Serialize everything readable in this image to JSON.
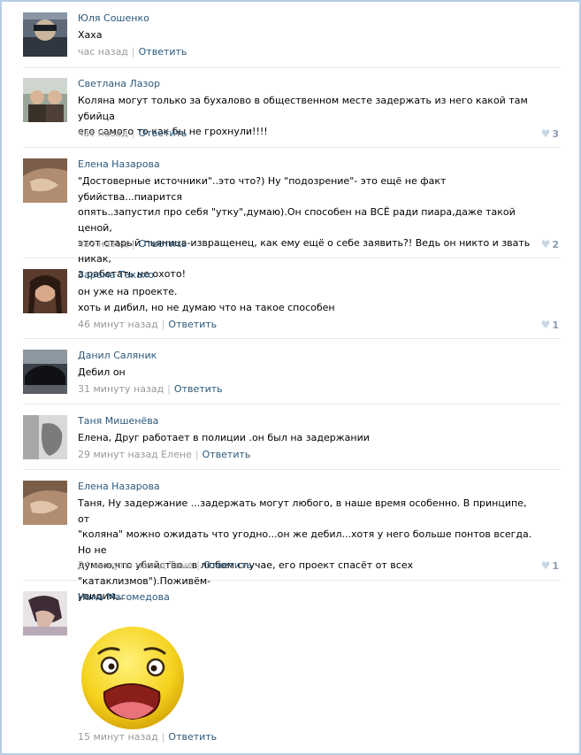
{
  "comments": [
    {
      "author": "Юля Сошенко",
      "lines": [
        "Хаха"
      ],
      "time": "час назад",
      "reply": "Ответить",
      "likes": ""
    },
    {
      "author": "Светлана Лазор",
      "lines": [
        "Коляна могут только за бухалово в общественном месте задержать из него какой там убийца",
        "его самого то как бы не грохнули!!!!"
      ],
      "time": "час назад",
      "reply": "Ответить",
      "likes": "3"
    },
    {
      "author": "Елена Назарова",
      "lines": [
        "\"Достоверные источники\"..это что?) Ну \"подозрение\"- это ещё не факт убийства...пиарится",
        "опять..запустил про себя \"утку\",думаю).Он способен на ВСЁ ради пиара,даже такой ценой,",
        "этот старый пьяница-извращенец, как ему ещё о себе заявить?! Ведь он никто и звать никак,",
        "а работать не охото!"
      ],
      "time": "час назад",
      "reply": "Ответить",
      "likes": "2"
    },
    {
      "author": "Зарема Такахо",
      "lines": [
        "он уже на проекте.",
        "хоть и дибил, но не думаю что на такое способен"
      ],
      "time": "46 минут назад",
      "reply": "Ответить",
      "likes": "1"
    },
    {
      "author": "Данил Саляник",
      "lines": [
        "Дебил он"
      ],
      "time": "31 минуту назад",
      "reply": "Ответить",
      "likes": ""
    },
    {
      "author": "Таня Мишенёва",
      "lines": [
        "Елена, Друг работает в полиции .он был на задержании"
      ],
      "time": "29 минут назад Елене",
      "reply": "Ответить",
      "likes": ""
    },
    {
      "author": "Елена Назарова",
      "lines": [
        "Таня, Ну задержание ...задержать могут любого, в наше время особенно. В принципе, от",
        "\"коляна\" можно ожидать что угодно...он же дебил...хотя у него больше понтов всегда. Но не",
        "думаю,что убийство...в любом случае, его проект спасёт от всех \"катаклизмов\").Поживём-",
        "увидим..."
      ],
      "time": "24 минуты назад Тане",
      "reply": "Ответить",
      "likes": "1"
    },
    {
      "author": "Нана Магомедова",
      "lines": [],
      "time": "15 минут назад",
      "reply": "Ответить",
      "likes": ""
    }
  ],
  "colors": {
    "link": "#2b587a",
    "meta": "#999999",
    "divider": "#e6e9ed",
    "frame": "#b6cde6"
  }
}
